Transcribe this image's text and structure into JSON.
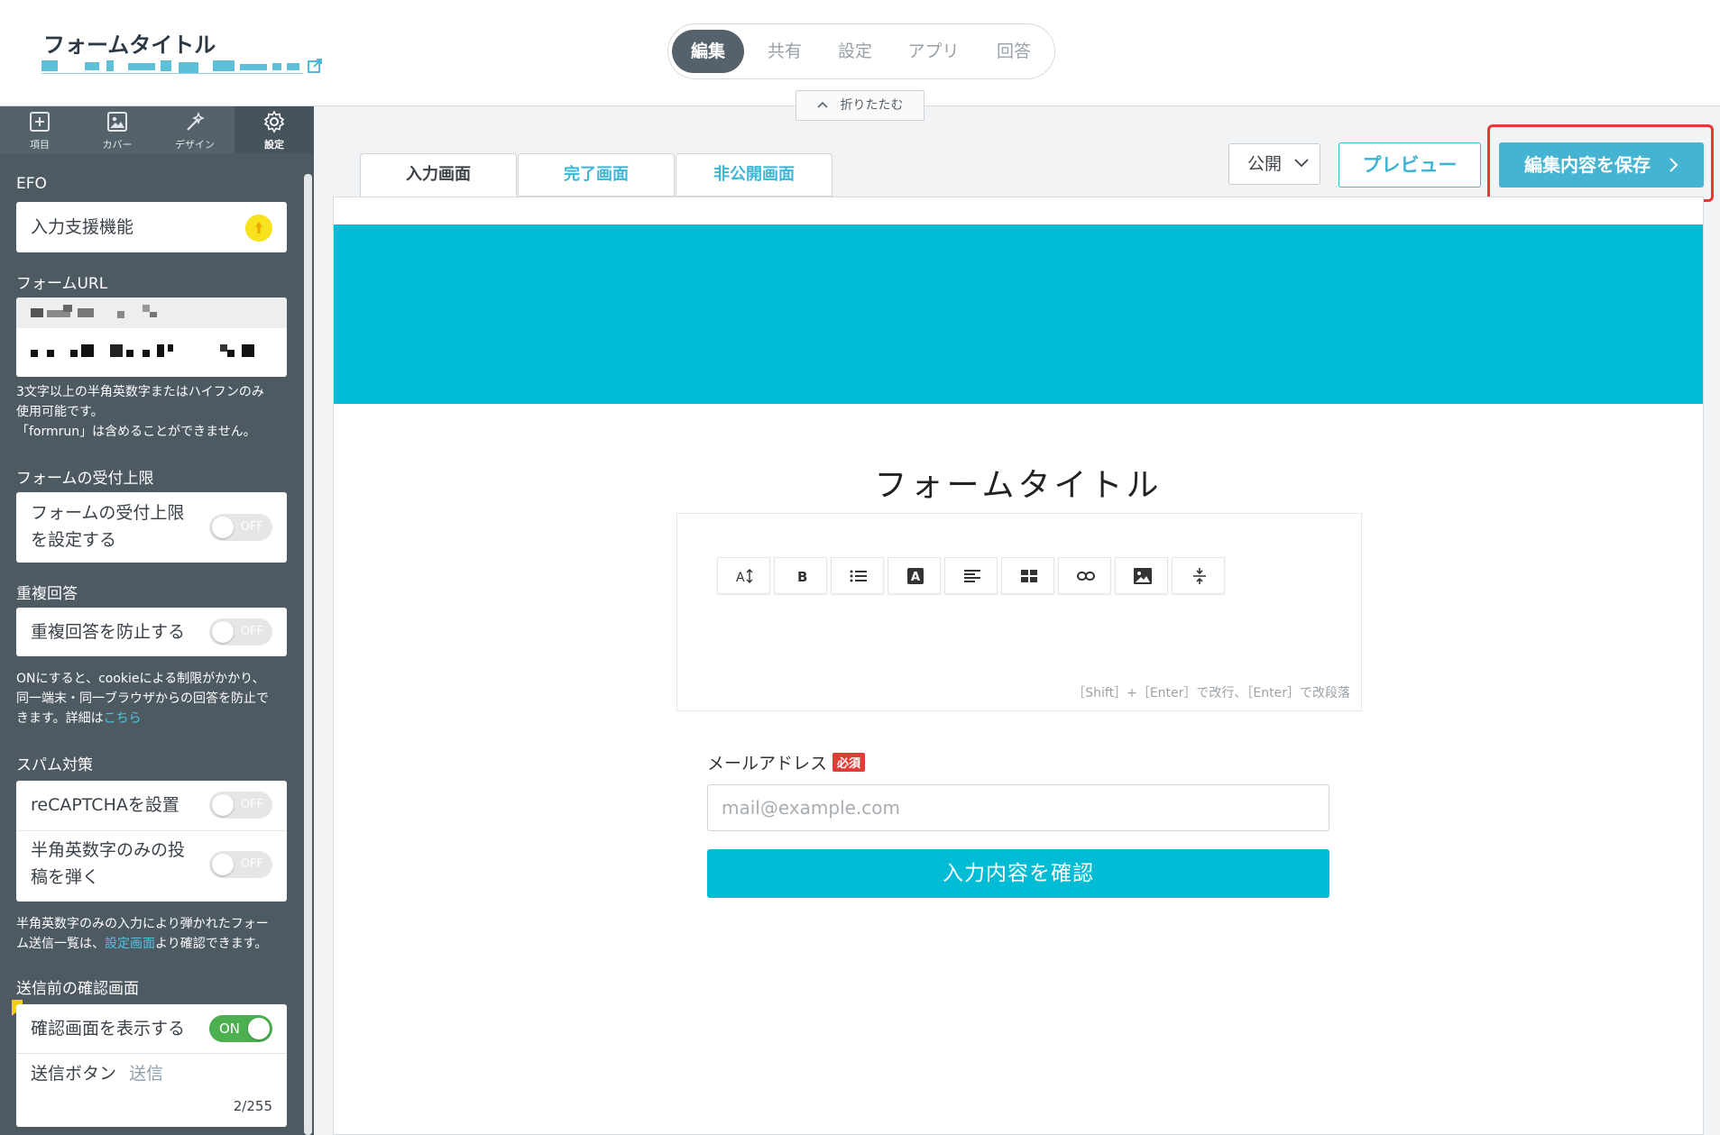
{
  "header": {
    "form_title": "フォームタイトル",
    "mode_tabs": [
      "編集",
      "共有",
      "設定",
      "アプリ",
      "回答"
    ],
    "active_mode": "編集",
    "collapse_label": "折りたたむ"
  },
  "sidebar": {
    "icons": [
      {
        "label": "項目",
        "icon": "add-box-icon"
      },
      {
        "label": "カバー",
        "icon": "image-icon"
      },
      {
        "label": "デザイン",
        "icon": "magic-wand-icon"
      },
      {
        "label": "設定",
        "icon": "gear-icon"
      }
    ],
    "efo": {
      "section": "EFO",
      "feature": "入力支援機能"
    },
    "form_url": {
      "section": "フォームURL",
      "note_lines": [
        "3文字以上の半角英数字またはハイフンのみ",
        "使用可能です。",
        "「formrun」は含めることができません。"
      ]
    },
    "limit": {
      "section": "フォームの受付上限",
      "label_lines": [
        "フォームの受付上限",
        "を設定する"
      ],
      "toggle": "OFF"
    },
    "duplicate": {
      "section": "重複回答",
      "label": "重複回答を防止する",
      "toggle": "OFF",
      "note_lines": [
        "ONにすると、cookieによる制限がかかり、",
        "同一端末・同一ブラウザからの回答を防止で",
        "きます。詳細は"
      ],
      "note_link": "こちら"
    },
    "spam": {
      "section": "スパム対策",
      "recaptcha_label": "reCAPTCHAを設置",
      "recaptcha_toggle": "OFF",
      "alnum_label_lines": [
        "半角英数字のみの投",
        "稿を弾く"
      ],
      "alnum_toggle": "OFF",
      "note_line1": "半角英数字のみの入力により弾かれたフォー",
      "note_line2_pre": "ム送信一覧は、",
      "note_link": "設定画面",
      "note_line2_post": "より確認できます。"
    },
    "confirm": {
      "section": "送信前の確認画面",
      "label": "確認画面を表示する",
      "toggle": "ON",
      "button_label": "送信ボタン",
      "button_value": "送信",
      "count": "2/255"
    }
  },
  "main": {
    "tabs": [
      "入力画面",
      "完了画面",
      "非公開画面"
    ],
    "active_tab": "入力画面",
    "publish_select": "公開",
    "preview_label": "プレビュー",
    "save_label": "編集内容を保存",
    "form_title": "フォームタイトル",
    "editor_hint": "［Shift］+［Enter］で改行、［Enter］で改段落",
    "editor_tools": [
      "text-size-icon",
      "bold-icon",
      "list-icon",
      "text-color-icon",
      "align-icon",
      "table-icon",
      "link-icon",
      "image-icon",
      "divider-icon"
    ],
    "email_label": "メールアドレス",
    "required_badge": "必須",
    "email_placeholder": "mail@example.com",
    "confirm_button": "入力内容を確認"
  },
  "colors": {
    "accent": "#00bcd4",
    "sidebar": "#4e5a62",
    "highlight": "#e53935",
    "toggle_on": "#4caf50",
    "required": "#e53935"
  }
}
